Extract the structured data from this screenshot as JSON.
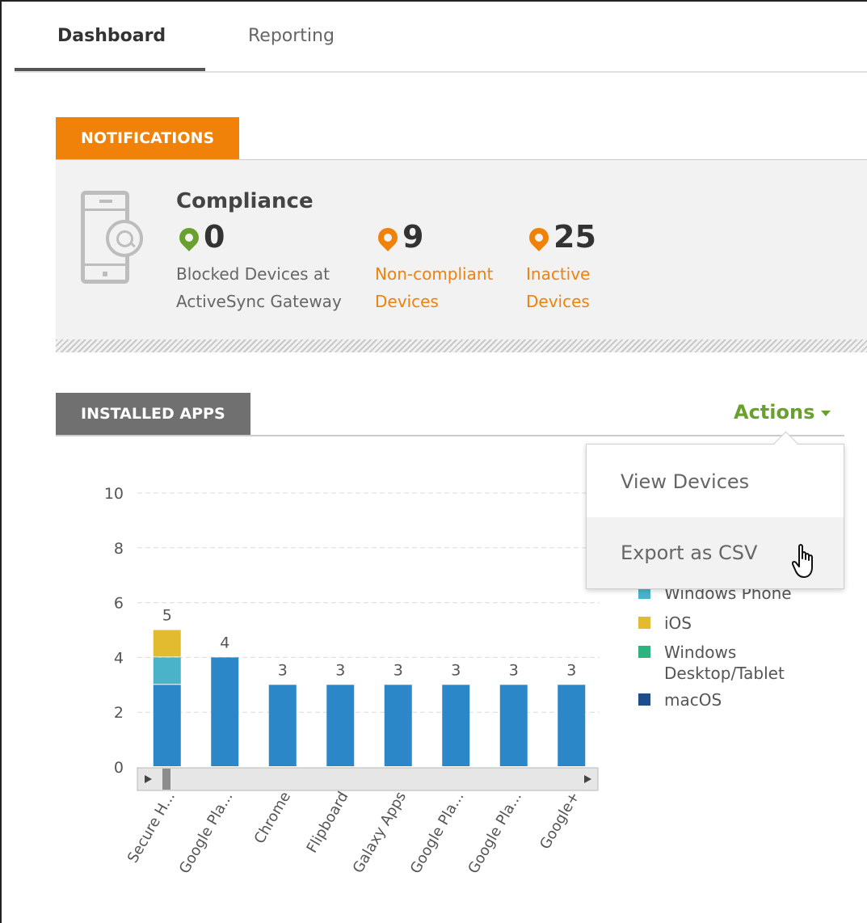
{
  "tabs": [
    {
      "label": "Dashboard",
      "active": true
    },
    {
      "label": "Reporting",
      "active": false
    }
  ],
  "notifications": {
    "header": "NOTIFICATIONS",
    "compliance": {
      "title": "Compliance",
      "stats": [
        {
          "value": "0",
          "line1": "Blocked Devices at",
          "line2": "ActiveSync Gateway",
          "pin": "green-pin-icon"
        },
        {
          "value": "9",
          "line1": "Non-compliant",
          "line2": "Devices",
          "pin": "orange-pin-icon"
        },
        {
          "value": "25",
          "line1": "Inactive",
          "line2": "Devices",
          "pin": "orange-pin-icon"
        }
      ]
    }
  },
  "installed_apps": {
    "header": "INSTALLED APPS",
    "actions_label": "Actions",
    "menu": {
      "items": [
        {
          "label": "View Devices"
        },
        {
          "label": "Export as CSV"
        }
      ]
    }
  },
  "legend": [
    {
      "label": "Windows Phone",
      "color": "#4ab3c9"
    },
    {
      "label": "iOS",
      "color": "#e2bb30"
    },
    {
      "label": "Windows",
      "label2": "Desktop/Tablet",
      "color": "#2db37f"
    },
    {
      "label": "macOS",
      "color": "#1d4e89"
    }
  ],
  "colors": {
    "orange": "#f0820a",
    "green": "#6aa12e",
    "android_bar": "#2b87c8"
  },
  "chart_data": {
    "type": "bar",
    "stacked": true,
    "categories": [
      "Secure H...",
      "Google Pla...",
      "Chrome",
      "Flipboard",
      "Galaxy Apps",
      "Google Pla...",
      "Google Pla...",
      "Google+"
    ],
    "series": [
      {
        "values": [
          3,
          4,
          3,
          3,
          3,
          3,
          3,
          3
        ],
        "color": "#2b87c8"
      },
      {
        "name": "Windows Phone",
        "values": [
          1,
          0,
          0,
          0,
          0,
          0,
          0,
          0
        ],
        "color": "#4ab3c9"
      },
      {
        "name": "iOS",
        "values": [
          1,
          0,
          0,
          0,
          0,
          0,
          0,
          0
        ],
        "color": "#e2bb30"
      },
      {
        "name": "Windows Desktop/Tablet",
        "values": [
          0,
          0,
          0,
          0,
          0,
          0,
          0,
          0
        ],
        "color": "#2db37f"
      },
      {
        "name": "macOS",
        "values": [
          0,
          0,
          0,
          0,
          0,
          0,
          0,
          0
        ],
        "color": "#1d4e89"
      }
    ],
    "totals": [
      5,
      4,
      3,
      3,
      3,
      3,
      3,
      3
    ],
    "ylim": [
      0,
      10
    ],
    "yticks": [
      0,
      2,
      4,
      6,
      8,
      10
    ],
    "grid": true,
    "legend_position": "right",
    "xlabel": "",
    "ylabel": ""
  }
}
